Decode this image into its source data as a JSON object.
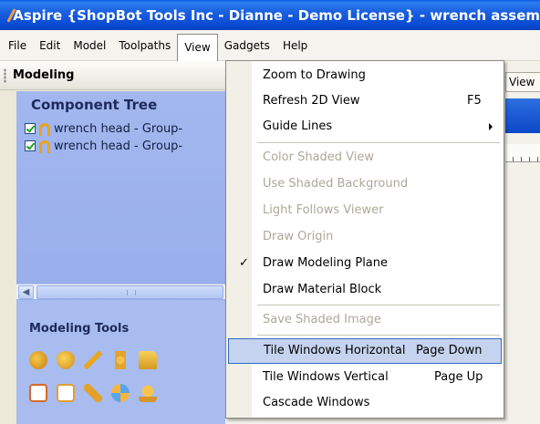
{
  "title_bar": {
    "title": "Aspire {ShopBot Tools Inc - Dianne - Demo License} - wrench assem"
  },
  "menu_bar": {
    "items": [
      "File",
      "Edit",
      "Model",
      "Toolpaths",
      "View",
      "Gadgets",
      "Help"
    ],
    "active": "View"
  },
  "left_pane": {
    "header": "Modeling",
    "component_tree": {
      "title": "Component Tree",
      "items": [
        {
          "label": "wrench head - Group-",
          "checked": true
        },
        {
          "label": "wrench head - Group-",
          "checked": true
        }
      ]
    },
    "tools": {
      "title": "Modeling Tools",
      "row1": [
        "create-shape-icon",
        "extrude-icon",
        "edit-icon",
        "weave-icon",
        "folder-icon"
      ],
      "row2": [
        "erase-icon",
        "frame-icon",
        "sculpt-icon",
        "move-icon",
        "smooth-icon"
      ]
    }
  },
  "right_pane": {
    "view_tab": "View"
  },
  "view_menu": {
    "items": [
      {
        "label": "Zoom to Drawing",
        "shortcut": "",
        "enabled": true
      },
      {
        "label": "Refresh 2D View",
        "shortcut": "F5",
        "enabled": true
      },
      {
        "label": "Guide Lines",
        "shortcut": "",
        "enabled": true,
        "submenu": true
      },
      {
        "label": "Color Shaded View",
        "shortcut": "",
        "enabled": false
      },
      {
        "label": "Use Shaded Background",
        "shortcut": "",
        "enabled": false
      },
      {
        "label": "Light Follows Viewer",
        "shortcut": "",
        "enabled": false
      },
      {
        "label": "Draw Origin",
        "shortcut": "",
        "enabled": false
      },
      {
        "label": "Draw Modeling Plane",
        "shortcut": "",
        "enabled": true,
        "checked": true
      },
      {
        "label": "Draw Material Block",
        "shortcut": "",
        "enabled": true
      },
      {
        "label": "Save Shaded Image",
        "shortcut": "",
        "enabled": false
      },
      {
        "label": "Tile Windows Horizontal",
        "shortcut": "Page Down",
        "enabled": true,
        "highlighted": true
      },
      {
        "label": "Tile Windows Vertical",
        "shortcut": "Page Up",
        "enabled": true
      },
      {
        "label": "Cascade Windows",
        "shortcut": "",
        "enabled": true
      }
    ],
    "check_glyph": "✓"
  }
}
